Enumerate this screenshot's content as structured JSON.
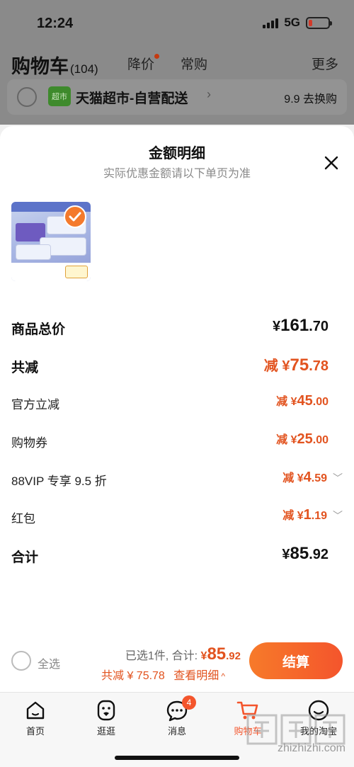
{
  "status_bar": {
    "time": "12:24",
    "network": "5G"
  },
  "cart_header": {
    "title": "购物车",
    "count": "(104)",
    "tabs": [
      {
        "label": "降价"
      },
      {
        "label": "常购"
      }
    ],
    "more": "更多",
    "store": {
      "logo_text": "超市",
      "name": "天猫超市-自营配送",
      "promo": "9.9 去换购"
    }
  },
  "sheet": {
    "title": "金额明细",
    "subtitle": "实际优惠金额请以下单页为准",
    "product_image_alt": "柔软亲肤 干湿两用 湿巾 100抽*5包装",
    "rows": [
      {
        "label": "商品总价",
        "prefix": "¥",
        "int": "161",
        "dec": ".70"
      },
      {
        "label": "共减",
        "prefix": "减 ¥",
        "int": "75",
        "dec": ".78"
      },
      {
        "label": "官方立减",
        "prefix": "减 ¥",
        "int": "45",
        "dec": ".00"
      },
      {
        "label": "购物券",
        "prefix": "减 ¥",
        "int": "25",
        "dec": ".00"
      },
      {
        "label": "88VIP 专享 9.5 折",
        "prefix": "减 ¥",
        "int": "4",
        "dec": ".59"
      },
      {
        "label": "红包",
        "prefix": "减 ¥",
        "int": "1",
        "dec": ".19"
      },
      {
        "label": "合计",
        "prefix": "¥",
        "int": "85",
        "dec": ".92"
      }
    ]
  },
  "checkout": {
    "select_all": "全选",
    "selected_text": "已选1件, 合计:",
    "total_prefix": "¥",
    "total_int": "85",
    "total_dec": ".92",
    "discount_text": "共减 ¥ 75.78",
    "detail_link": "查看明细",
    "button": "结算"
  },
  "tabbar": {
    "items": [
      {
        "label": "首页",
        "icon": "home-icon"
      },
      {
        "label": "逛逛",
        "icon": "browse-icon"
      },
      {
        "label": "消息",
        "icon": "message-icon",
        "badge": "4"
      },
      {
        "label": "购物车",
        "icon": "cart-icon"
      },
      {
        "label": "我的淘宝",
        "icon": "profile-icon"
      }
    ]
  },
  "watermark": "zhizhizhi.com",
  "colors": {
    "accent": "#f4552c",
    "price": "#e2531f",
    "overlay": "#8a8a8a"
  }
}
